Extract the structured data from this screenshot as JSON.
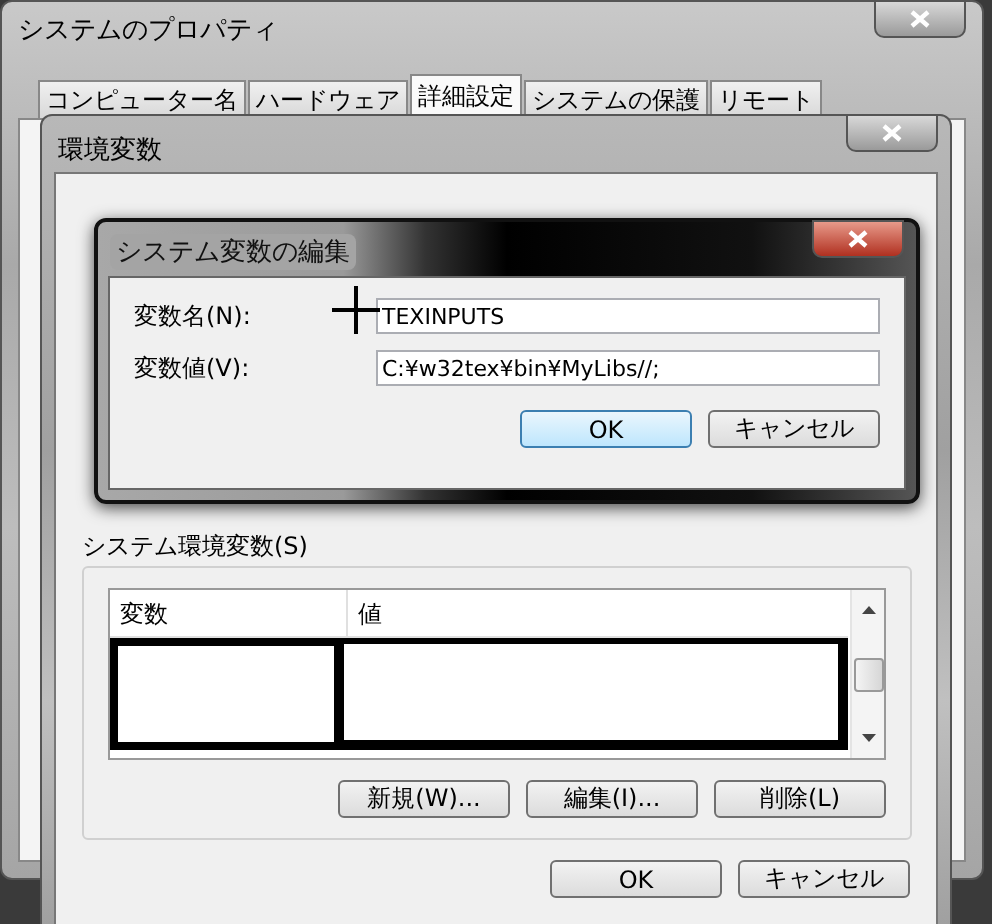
{
  "system_properties": {
    "title": "システムのプロパティ",
    "tabs": [
      {
        "label": "コンピューター名",
        "selected": false
      },
      {
        "label": "ハードウェア",
        "selected": false
      },
      {
        "label": "詳細設定",
        "selected": true
      },
      {
        "label": "システムの保護",
        "selected": false
      },
      {
        "label": "リモート",
        "selected": false
      }
    ]
  },
  "environment_variables": {
    "title": "環境変数",
    "system_group": {
      "label": "システム環境変数(S)",
      "columns": [
        "変数",
        "値"
      ],
      "buttons": [
        "新規(W)...",
        "編集(I)...",
        "削除(L)"
      ]
    },
    "buttons": [
      "OK",
      "キャンセル"
    ]
  },
  "edit_dialog": {
    "title": "システム変数の編集",
    "fields": [
      {
        "label": "変数名(N):",
        "value": "TEXINPUTS"
      },
      {
        "label": "変数値(V):",
        "value": "C:¥w32tex¥bin¥MyLibs//;"
      }
    ],
    "buttons": [
      {
        "label": "OK",
        "default": true
      },
      {
        "label": "キャンセル",
        "default": false
      }
    ]
  }
}
